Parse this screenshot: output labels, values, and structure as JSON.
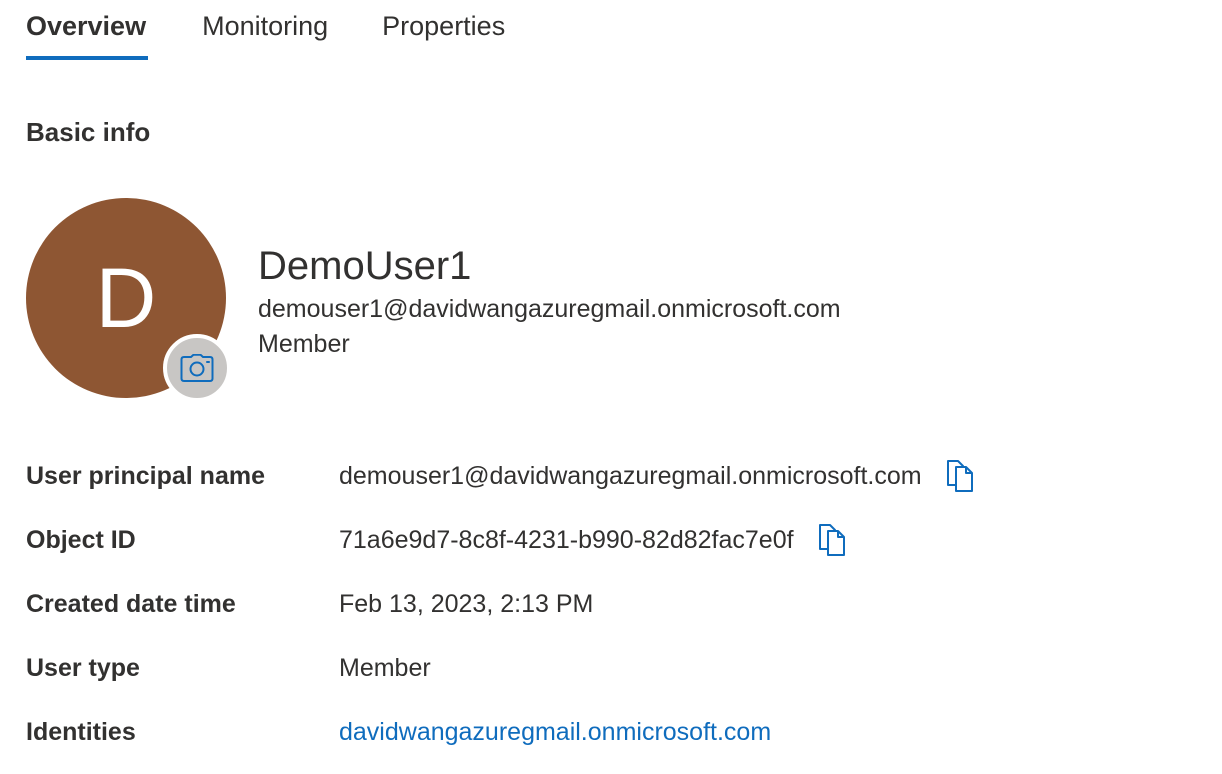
{
  "tabs": [
    {
      "label": "Overview",
      "active": true
    },
    {
      "label": "Monitoring",
      "active": false
    },
    {
      "label": "Properties",
      "active": false
    }
  ],
  "basic_info": {
    "title": "Basic info"
  },
  "user": {
    "initial": "D",
    "display_name": "DemoUser1",
    "email": "demouser1@davidwangazuregmail.onmicrosoft.com",
    "type": "Member"
  },
  "properties": {
    "upn_label": "User principal name",
    "upn_value": "demouser1@davidwangazuregmail.onmicrosoft.com",
    "object_id_label": "Object ID",
    "object_id_value": "71a6e9d7-8c8f-4231-b990-82d82fac7e0f",
    "created_label": "Created date time",
    "created_value": "Feb 13, 2023, 2:13 PM",
    "user_type_label": "User type",
    "user_type_value": "Member",
    "identities_label": "Identities",
    "identities_value": "davidwangazuregmail.onmicrosoft.com"
  },
  "icons": {
    "camera": "camera-icon",
    "copy": "copy-icon"
  },
  "colors": {
    "accent": "#0f6cbd",
    "avatar_bg": "#8e5633",
    "camera_bg": "#c8c6c4",
    "text": "#323130"
  }
}
